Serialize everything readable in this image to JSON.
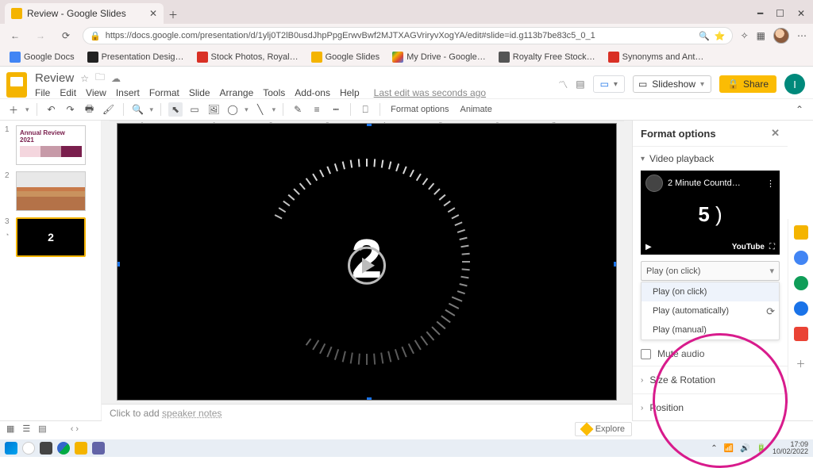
{
  "browser": {
    "tab_title": "Review - Google Slides",
    "url": "https://docs.google.com/presentation/d/1ylj0T2lB0usdJhpPpgErwvBwf2MJTXAGVriryvXogYA/edit#slide=id.g113b7be83c5_0_1",
    "bookmarks": [
      "Google Docs",
      "Presentation Desig…",
      "Stock Photos, Royal…",
      "Google Slides",
      "My Drive - Google…",
      "Royalty Free Stock…",
      "Synonyms and Ant…"
    ]
  },
  "doc": {
    "title": "Review",
    "menus": [
      "File",
      "Edit",
      "View",
      "Insert",
      "Format",
      "Slide",
      "Arrange",
      "Tools",
      "Add-ons",
      "Help"
    ],
    "edit_status": "Last edit was seconds ago",
    "slideshow": "Slideshow",
    "share": "Share",
    "user_initial": "I"
  },
  "toolbar": {
    "format_options": "Format options",
    "animate": "Animate"
  },
  "filmstrip": {
    "slide1_line1": "Annual Review",
    "slide1_line2": "2021",
    "slide3_num": "2"
  },
  "canvas": {
    "big_number": "2",
    "ruler_marks": [
      "1",
      "",
      "1",
      "2",
      "3",
      "4",
      "5",
      "6",
      "7"
    ]
  },
  "notes": {
    "prefix": "Click to add ",
    "link": "speaker notes"
  },
  "panel": {
    "title": "Format options",
    "section_playback": "Video playback",
    "video_title": "2 Minute Countd…",
    "video_count": "5",
    "youtube": "YouTube",
    "play_selected": "Play (on click)",
    "play_options": [
      "Play (on click)",
      "Play (automatically)",
      "Play (manual)"
    ],
    "mute": "Mute audio",
    "size_rotation": "Size & Rotation",
    "position": "Position"
  },
  "explore": "Explore",
  "taskbar": {
    "time": "17:09",
    "date": "10/02/2022"
  }
}
